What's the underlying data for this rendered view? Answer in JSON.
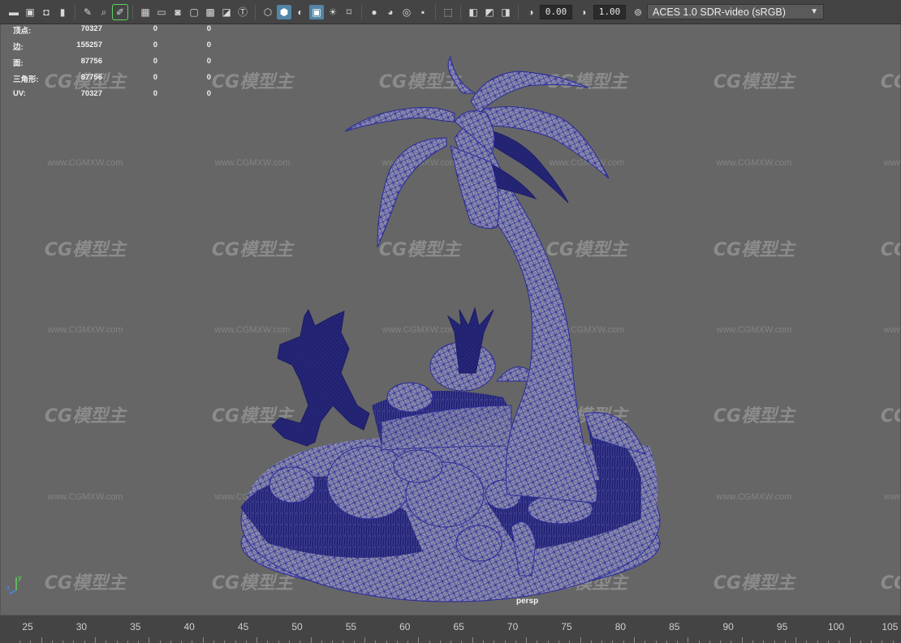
{
  "toolbar": {
    "icons": [
      "camera-icon",
      "camera-attributes-icon",
      "camera-lock-icon",
      "bookmark-icon",
      "grease-pencil-icon",
      "image-plane-icon",
      "2d-pan-zoom-icon",
      "paint-brush-icon",
      "grid-icon",
      "film-gate-icon",
      "resolution-gate-icon",
      "gate-mask-icon",
      "field-chart-icon",
      "safe-action-icon",
      "safe-title-icon",
      "wireframe-icon",
      "smooth-shade-icon",
      "shaded-wireframe-icon",
      "textured-icon",
      "lights-icon",
      "shadows-icon",
      "screen-space-ao-icon",
      "motion-blur-icon",
      "anti-aliasing-icon",
      "depth-of-field-icon",
      "isolate-select-icon",
      "xray-icon",
      "xray-joints-icon",
      "backface-icon"
    ],
    "exposure_value": "0.00",
    "gamma_value": "1.00",
    "color_space": "ACES 1.0 SDR-video (sRGB)"
  },
  "hud": {
    "rows": [
      {
        "label": "顶点:",
        "v1": "70327",
        "v2": "0",
        "v3": "0"
      },
      {
        "label": "边:",
        "v1": "155257",
        "v2": "0",
        "v3": "0"
      },
      {
        "label": "面:",
        "v1": "87756",
        "v2": "0",
        "v3": "0"
      },
      {
        "label": "三角形:",
        "v1": "87756",
        "v2": "0",
        "v3": "0"
      },
      {
        "label": "UV:",
        "v1": "70327",
        "v2": "0",
        "v3": "0"
      }
    ]
  },
  "viewport": {
    "camera": "persp",
    "mesh_color": "#2a2a9a",
    "background": "#666666"
  },
  "watermark": {
    "logo_text": "CG模型主",
    "url_text": "www.CGMXW.com"
  },
  "axis": {
    "y_label": "y",
    "z_label": "z"
  },
  "timeline": {
    "ticks": [
      "25",
      "30",
      "35",
      "40",
      "45",
      "50",
      "55",
      "60",
      "65",
      "70",
      "75",
      "80",
      "85",
      "90",
      "95",
      "100",
      "105"
    ]
  }
}
